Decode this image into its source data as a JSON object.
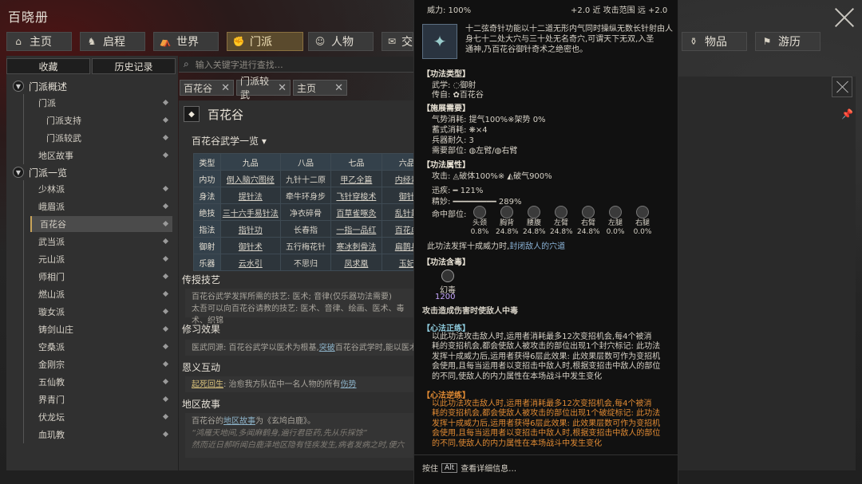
{
  "app": {
    "title": "百晓册"
  },
  "nav": {
    "tabs": [
      {
        "label": "主页",
        "icon": "home-icon"
      },
      {
        "label": "启程",
        "icon": "horse-icon"
      },
      {
        "label": "世界",
        "icon": "tent-icon"
      },
      {
        "label": "门派",
        "icon": "fist-icon",
        "active": true
      },
      {
        "label": "人物",
        "icon": "person-icon"
      },
      {
        "label": "交",
        "icon": "chat-icon"
      },
      {
        "label": "物品",
        "icon": "item-icon"
      },
      {
        "label": "游历",
        "icon": "travel-icon"
      }
    ]
  },
  "sidebar": {
    "favorites": "收藏",
    "history": "历史记录",
    "g1": "门派概述",
    "g1_items": [
      "门派",
      "门派支持",
      "门派较武",
      "地区故事"
    ],
    "g2": "门派一览",
    "g2_items": [
      "少林派",
      "峨眉派",
      "百花谷",
      "武当派",
      "元山派",
      "师相门",
      "燃山派",
      "璇女派",
      "铸剑山庄",
      "空桑派",
      "金刚宗",
      "五仙教",
      "界青门",
      "伏龙坛",
      "血玑教"
    ]
  },
  "search": {
    "placeholder": "输入关键字进行查找…"
  },
  "content_tabs": [
    "百花谷",
    "门派较武",
    "主页"
  ],
  "page": {
    "title": "百花谷",
    "table_title": "百花谷武学一览",
    "grid": {
      "headers": [
        "类型",
        "九品",
        "八品",
        "七品",
        "六品"
      ],
      "rows": [
        [
          "内功",
          "倒入脑穴图经",
          "九针十二原",
          "甲乙全篇",
          "内经素"
        ],
        [
          "身法",
          "提针法",
          "牵牛环身步",
          "飞针穿梭术",
          "御针"
        ],
        [
          "绝技",
          "三十六手易针法",
          "净衣碎骨",
          "百草雀啄灸",
          "乱针封"
        ],
        [
          "指法",
          "指针功",
          "长春指",
          "一指一品红",
          "百花虚"
        ],
        [
          "御射",
          "御针术",
          "五行梅花针",
          "寒冰刺骨法",
          "扁鹊兵"
        ],
        [
          "乐器",
          "云水引",
          "不思归",
          "凤求凰",
          "玉妃"
        ]
      ]
    },
    "s1": "传授技艺",
    "s1_text": "百花谷武学发挥所需的技艺: 医术; 音律(仅乐器功法需要)",
    "s1_text2": "太吾可以向百花谷请教的技艺: 医术、音律、绘画、医术、毒术、织锦",
    "s2": "修习效果",
    "s2_text": "医武同源: 百花谷武学以医术为根基,",
    "s2_link": "突破",
    "s2_text2": "百花谷武学时,能以医术",
    "s3": "恩义互动",
    "s3_link": "起死回生",
    "s3_text": ": 治愈我方队伍中一名人物的所有",
    "s3_link2": "伤势",
    "s4": "地区故事",
    "s4_text": "百花谷的",
    "s4_link": "地区故事",
    "s4_text2": "为《玄鸠白鹿》。",
    "s4_q1": "“鸿雁天地间,多闻麻鹤身,遍行君臣药,先从乐採馀”",
    "s4_q2": "然而近日郝听闻白鹿泽地区隐有怪疾发生,病者发病之时,便六"
  },
  "tooltip": {
    "power_label": "威力: 100%",
    "range": "+2.0 近  攻击范围 远 +2.0",
    "desc": [
      "十二弦奇针功能以十二道无形内气同时操纵无数长针射由人",
      "身七十二处大穴与三十处无名奇穴,可谓天下无双,入圣",
      "通神,乃百花谷御针奇术之绝密也。"
    ],
    "type_h": "【功法类型】",
    "wuxue": "武学: ◌御射",
    "chuanshou": "传自: ✿百花谷",
    "need_h": "【施展需要】",
    "need1": "气势消耗: 提气100%※架势 0%",
    "need2": "蓄式消耗: ❋×4",
    "need3": "兵器耐久: 3",
    "need4": "需要部位: ◍左臂/◍右臂",
    "attr_h": "【功法属性】",
    "attack": "攻击: ◬破体100%※ ◭破气900%",
    "speed": "迅疾: ━ 121%",
    "precise": "精妙: ━━━━━━━━━ 289%",
    "hit_label": "命中部位:",
    "hits": [
      {
        "n": "头颈",
        "v": "0.8%"
      },
      {
        "n": "胸背",
        "v": "24.8%"
      },
      {
        "n": "腰腹",
        "v": "24.8%"
      },
      {
        "n": "左臂",
        "v": "24.8%"
      },
      {
        "n": "右臂",
        "v": "24.8%"
      },
      {
        "n": "左腿",
        "v": "0.0%"
      },
      {
        "n": "右腿",
        "v": "0.0%"
      }
    ],
    "full_power": "此功法发挥十成威力时,",
    "full_power_link": "封闭敌人的穴道",
    "poison_h": "【功法含毒】",
    "poison_name": "幻毒",
    "poison_val": "1200",
    "poison_text": "攻击造成伤害时使敌人中毒",
    "zheng_h": "【心法正练】",
    "zheng_text": [
      "以此功法攻击敌人时,运用者消耗最多12次变招机会,每4个被消",
      "耗的变招机会,都会使敌人被攻击的部位出现1个封穴标记: 此功法",
      "发挥十成威力后,运用者获得6层此效果: 此效果层数可作为变招机",
      "会使用,且每当运用者以变招击中敌人时,根据变招击中敌人的部位",
      "的不同,使敌人的内力属性在本场战斗中发生变化"
    ],
    "ni_h": "【心法逆练】",
    "ni_text": [
      "以此功法攻击敌人时,运用者消耗最多12次变招机会,每4个被消",
      "耗的变招机会,都会使敌人被攻击的部位出现1个破绽标记: 此功法",
      "发挥十成威力后,运用者获得6层此效果: 此效果层数可作为变招机",
      "会使用,且每当运用者以变招击中敌人时,根据变招击中敌人的部位",
      "的不同,使敌人的内力属性在本场战斗中发生变化"
    ],
    "footer": "按住",
    "footer_key": "Alt",
    "footer2": "查看详细信息…"
  }
}
